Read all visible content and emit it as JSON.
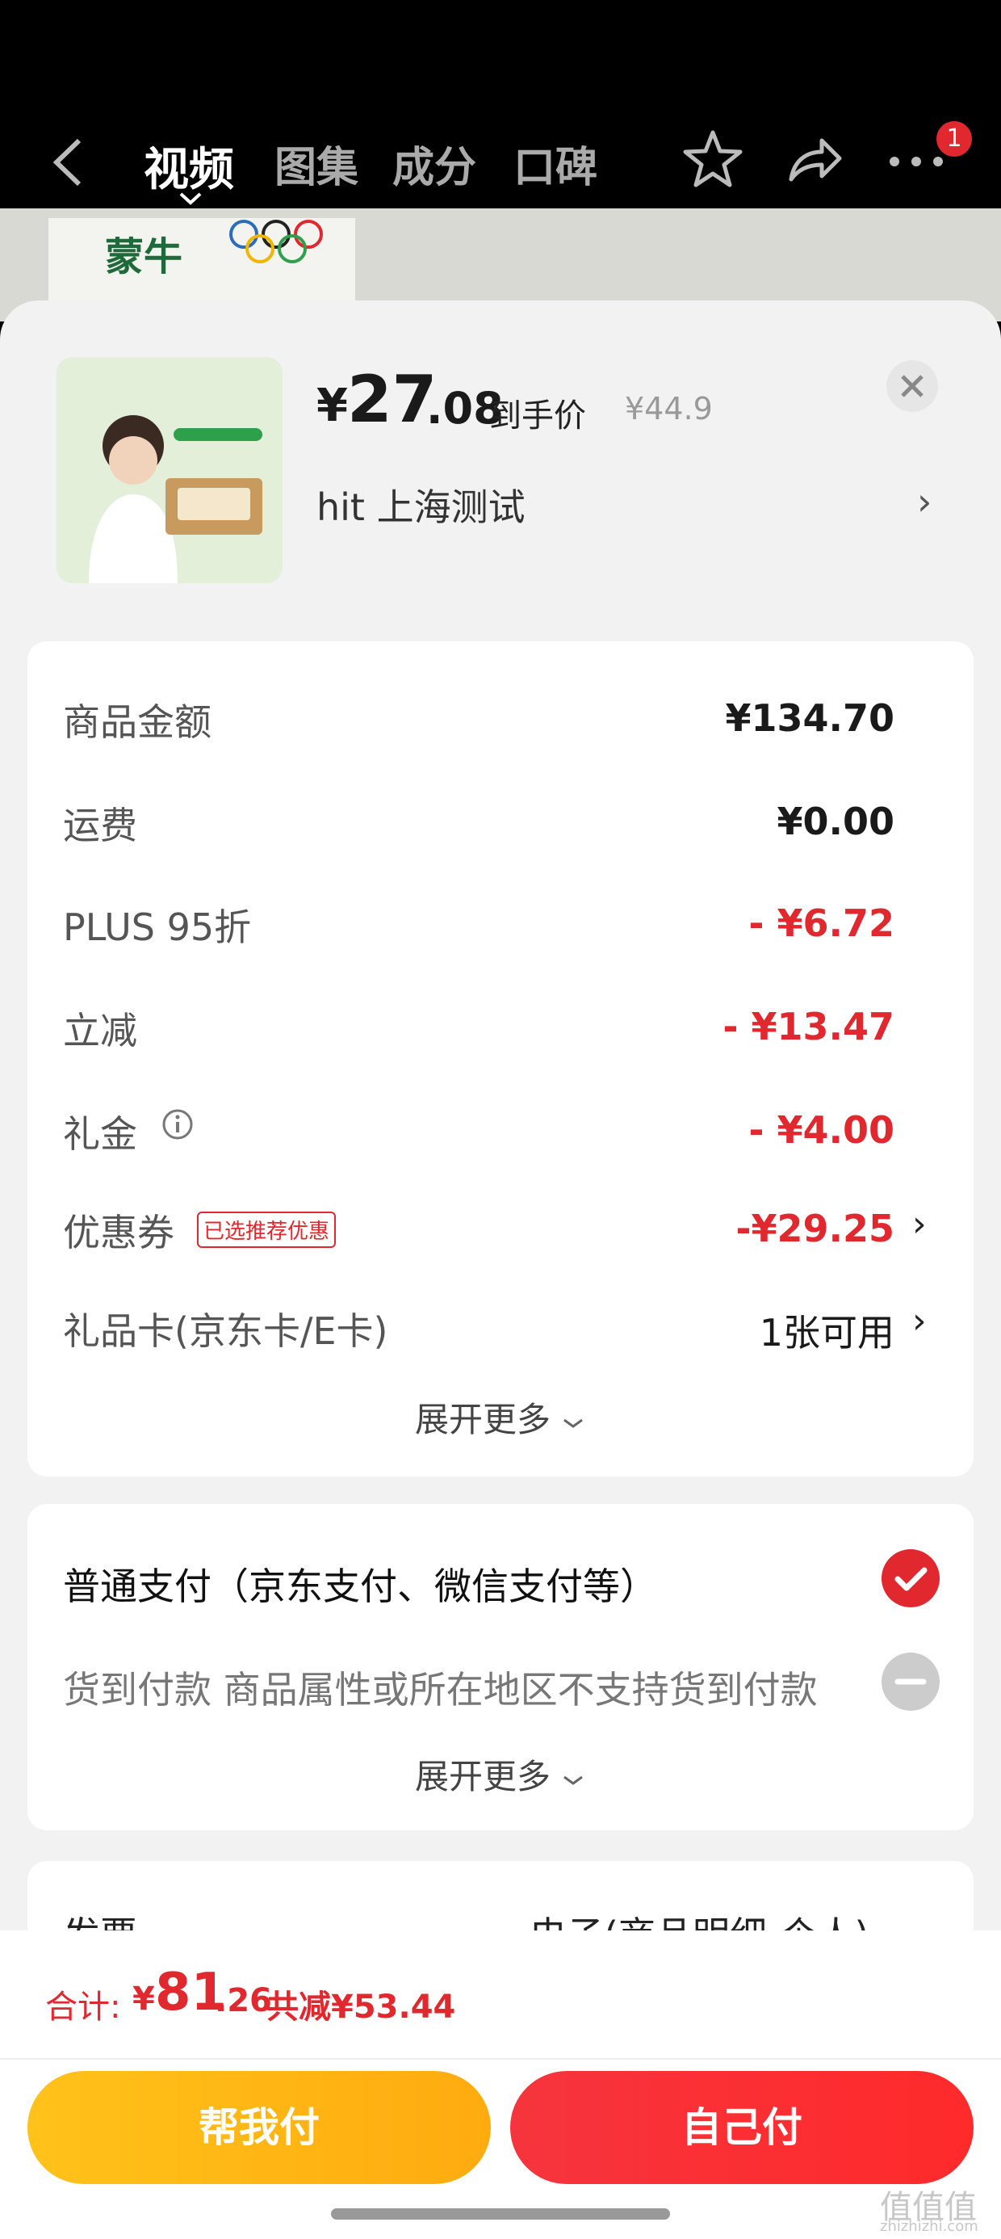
{
  "nav": {
    "tabs": [
      "视频",
      "图集",
      "成分",
      "口碑"
    ],
    "badge_count": "1"
  },
  "banner": {
    "brand_text": "蒙牛"
  },
  "product": {
    "price_symbol": "¥",
    "price_int": "27",
    "price_dec": ".08",
    "price_label": "到手价",
    "original_price": "¥44.9",
    "store_name": "hit  上海测试",
    "store_chevron": "›"
  },
  "summary": {
    "rows": [
      {
        "label": "商品金额",
        "value": "¥134.70",
        "color": "#1a1a1a"
      },
      {
        "label": "运费",
        "value": "¥0.00",
        "color": "#1a1a1a"
      },
      {
        "label": "PLUS 95折",
        "value": "- ¥6.72",
        "color": "#e0282e"
      },
      {
        "label": "立减",
        "value": "- ¥13.47",
        "color": "#e0282e"
      },
      {
        "label": "礼金",
        "value": "- ¥4.00",
        "color": "#e0282e"
      },
      {
        "label": "优惠券",
        "value": "-¥29.25",
        "color": "#e0282e",
        "tag": "已选推荐优惠"
      },
      {
        "label": "礼品卡(京东卡/E卡)",
        "value": "1张可用",
        "color": "#1a1a1a"
      }
    ],
    "expand_label": "展开更多"
  },
  "payment": {
    "option1": "普通支付（京东支付、微信支付等）",
    "option2": "货到付款 商品属性或所在地区不支持货到付款",
    "expand_label": "展开更多"
  },
  "invoice": {
    "label": "发票",
    "value": "电子(商品明细-个人)"
  },
  "footer": {
    "total_label": "合计:",
    "total_symbol": "¥",
    "total_int": "81",
    "total_dec": ".26",
    "saved": "共减¥53.44",
    "help_pay": "帮我付",
    "self_pay": "自己付"
  },
  "watermark": {
    "main": "值值值",
    "sub": "zhizhizhi.com"
  },
  "colors": {
    "accent": "#e0282e",
    "help_btn": "#ffb514"
  }
}
